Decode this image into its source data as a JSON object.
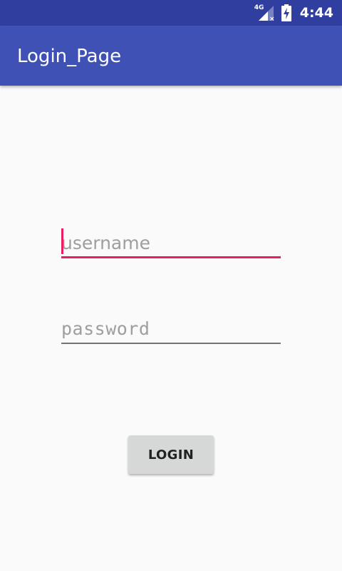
{
  "status_bar": {
    "network_label": "4G",
    "time": "4:44",
    "icons": [
      "cellular-signal-icon",
      "battery-charging-icon"
    ]
  },
  "app_bar": {
    "title": "Login_Page"
  },
  "form": {
    "username": {
      "value": "",
      "placeholder": "username",
      "focused": true
    },
    "password": {
      "value": "",
      "placeholder": "password"
    },
    "login_label": "LOGIN"
  },
  "colors": {
    "status_bar": "#303f9f",
    "app_bar": "#3f51b5",
    "accent": "#e91e63",
    "background": "#fafafa",
    "button": "#d6d7d7"
  }
}
